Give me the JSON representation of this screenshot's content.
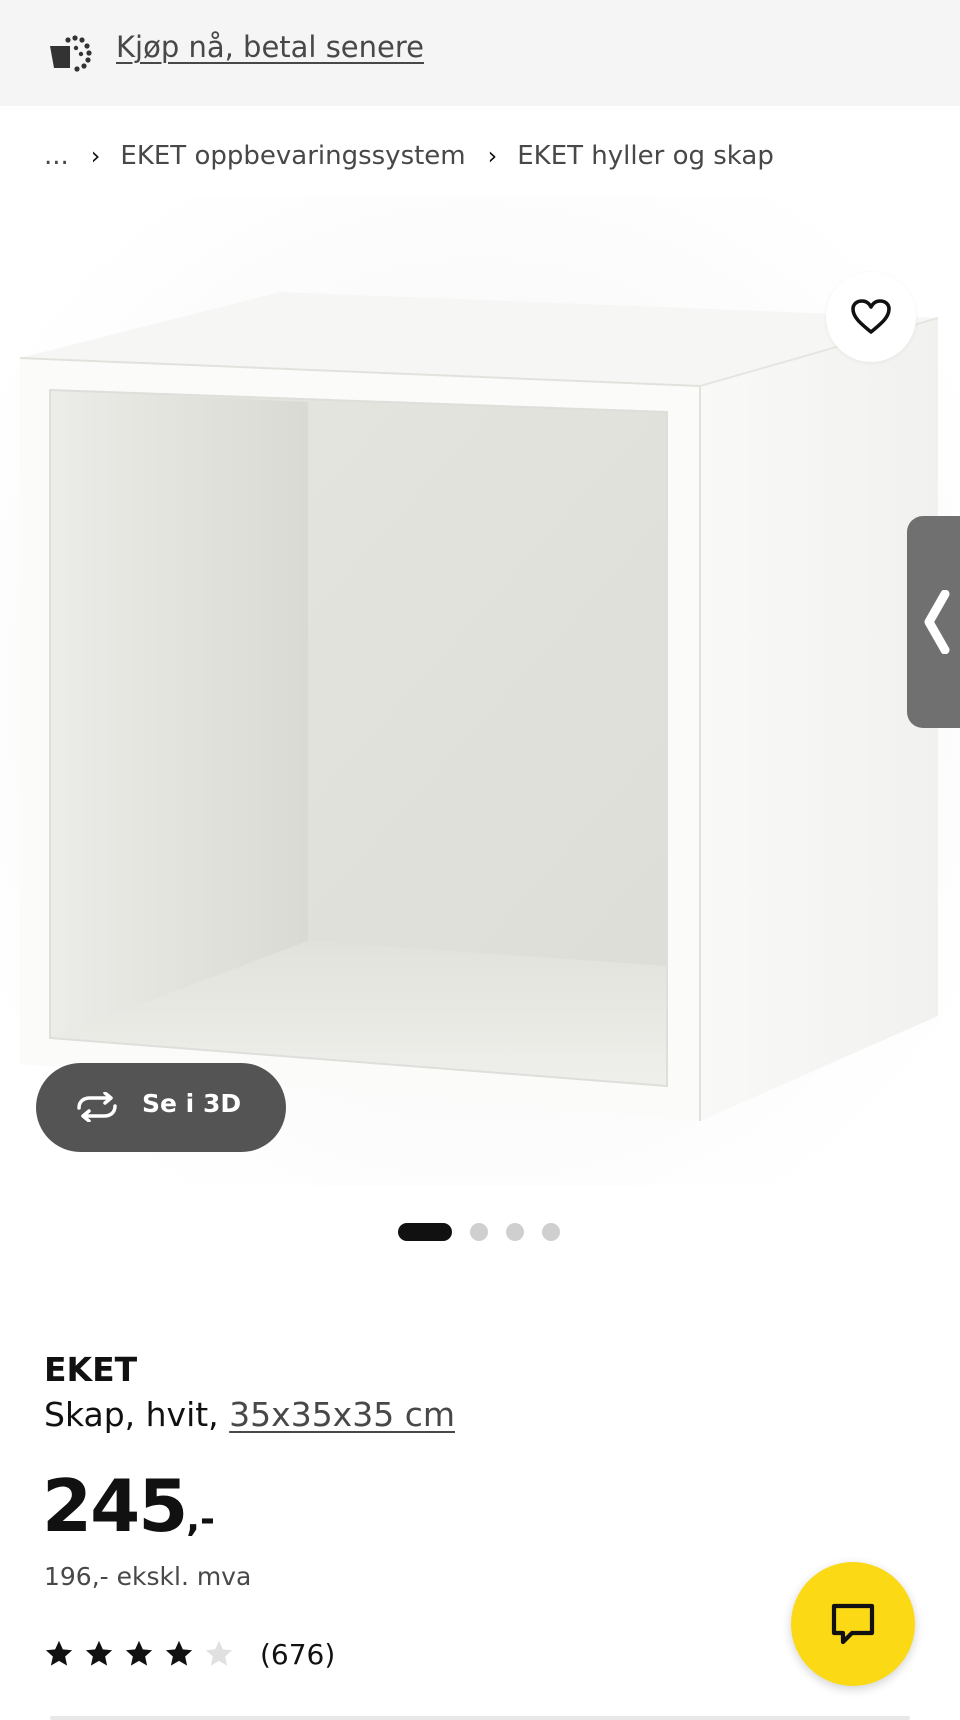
{
  "top_banner": {
    "icon": "buy-now-pay-later-icon",
    "link_text": "Kjøp nå, betal senere"
  },
  "breadcrumb": {
    "ellipsis": "...",
    "items": [
      {
        "label": "EKET oppbevaringssystem"
      },
      {
        "label": "EKET hyller og skap"
      }
    ]
  },
  "gallery": {
    "view_3d_label": "Se i 3D",
    "favorite_icon": "heart-icon",
    "side_tab_icon": "chevron-left-icon",
    "image_count": 4,
    "active_index": 0
  },
  "product": {
    "brand": "EKET",
    "description_prefix": "Skap, hvit, ",
    "size_link": "35x35x35 cm",
    "price_main": "245",
    "price_suffix": ",-",
    "price_ex_vat": "196,- ekskl. mva",
    "rating_value": 4,
    "rating_max": 5,
    "review_count": "(676)"
  },
  "chat": {
    "icon": "chat-bubble-icon",
    "color": "#fbd914"
  },
  "colors": {
    "topbar_bg": "#f5f5f5",
    "dark_button": "#545454",
    "side_tab": "#707070",
    "star_filled": "#111111",
    "star_empty": "#e0e0e0"
  }
}
